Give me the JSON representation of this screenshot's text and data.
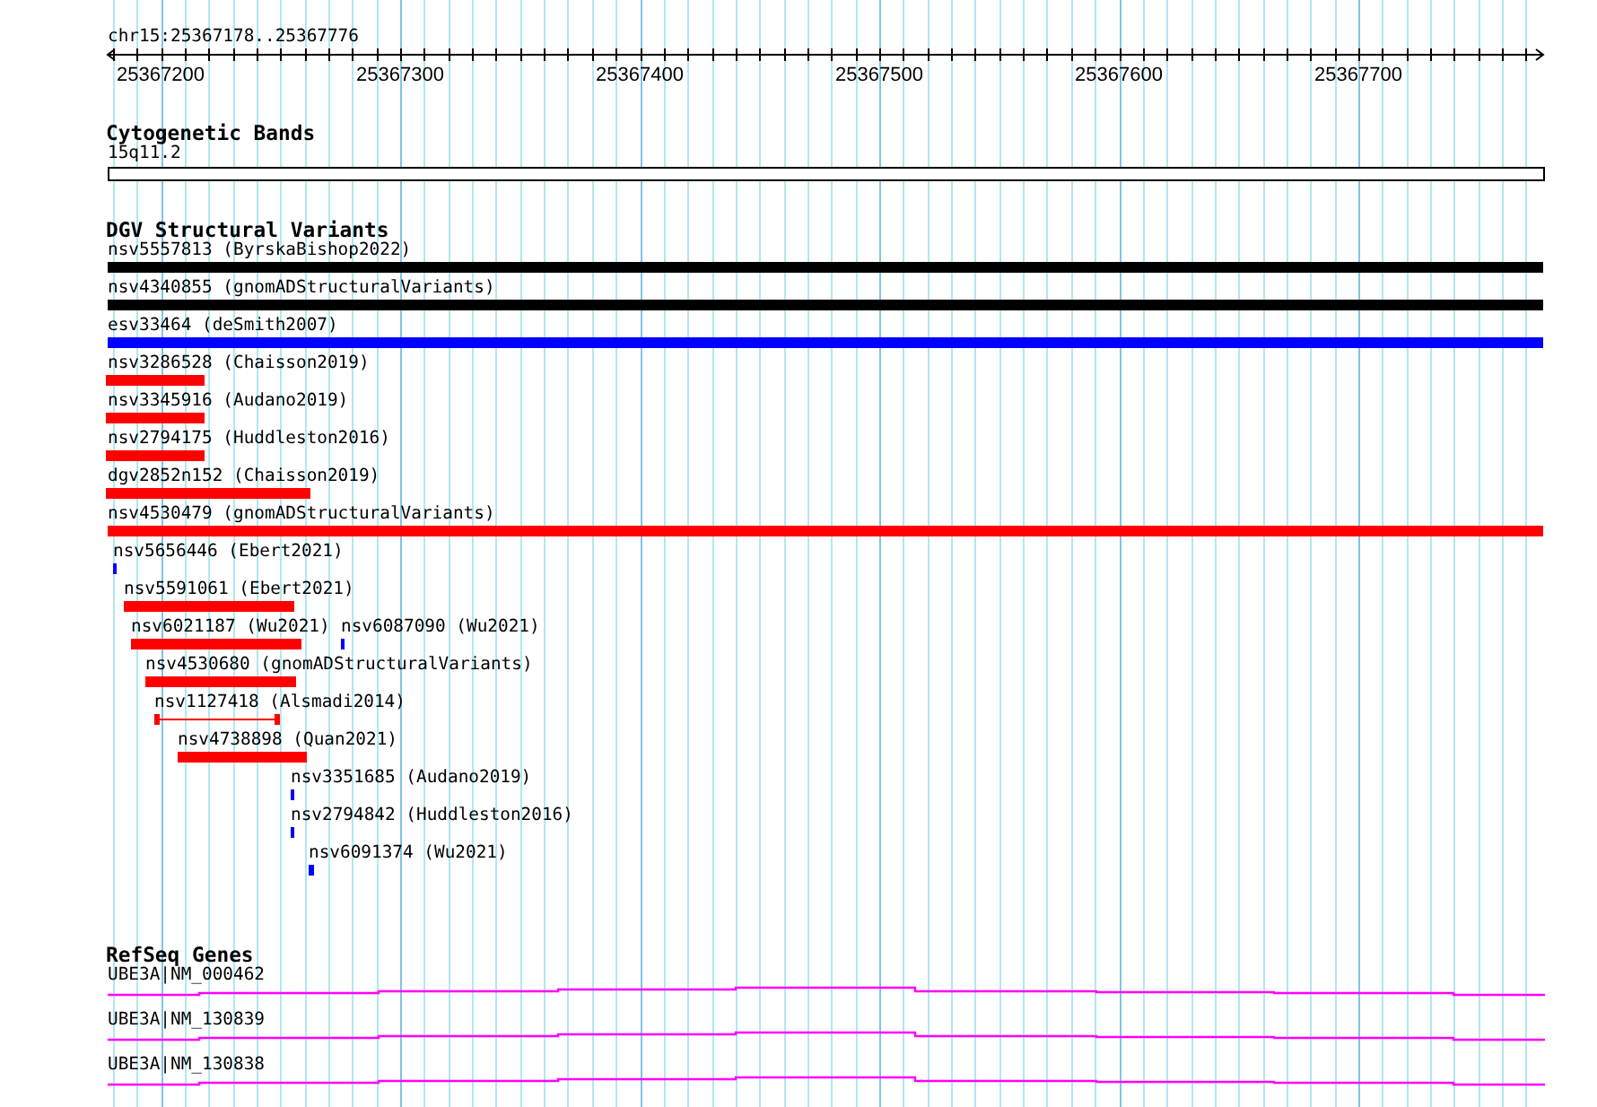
{
  "ruler": {
    "location": "chr15:25367178..25367776",
    "ticks": [
      "25367200",
      "25367300",
      "25367400",
      "25367500",
      "25367600",
      "25367700"
    ]
  },
  "tracks": [
    {
      "title": "Cytogenetic Bands",
      "kind": "bands",
      "features": [
        {
          "label": "15q11.2"
        }
      ]
    },
    {
      "title": "DGV Structural Variants",
      "kind": "variants",
      "features": [
        {
          "label": "nsv5557813 (ByrskaBishop2022)",
          "kind": "bar",
          "color": "#000000"
        },
        {
          "label": "nsv4340855 (gnomADStructuralVariants)",
          "kind": "bar",
          "color": "#000000"
        },
        {
          "label": "esv33464 (deSmith2007)",
          "kind": "bar",
          "color": "#0000ff"
        },
        {
          "label": "nsv3286528 (Chaisson2019)",
          "kind": "bar",
          "color": "#ff0000"
        },
        {
          "label": "nsv3345916 (Audano2019)",
          "kind": "bar",
          "color": "#ff0000"
        },
        {
          "label": "nsv2794175 (Huddleston2016)",
          "kind": "bar",
          "color": "#ff0000"
        },
        {
          "label": "dgv2852n152 (Chaisson2019)",
          "kind": "bar",
          "color": "#ff0000"
        },
        {
          "label": "nsv4530479 (gnomADStructuralVariants)",
          "kind": "bar",
          "color": "#ff0000"
        },
        {
          "label": "nsv5656446 (Ebert2021)",
          "kind": "bar",
          "color": "#0000ff"
        },
        {
          "label": "nsv5591061 (Ebert2021)",
          "kind": "bar",
          "color": "#ff0000"
        },
        {
          "label": "nsv6021187 (Wu2021)",
          "kind": "bar",
          "color": "#ff0000"
        },
        {
          "label": "nsv6087090 (Wu2021)",
          "kind": "bar",
          "color": "#0000ff"
        },
        {
          "label": "nsv4530680 (gnomADStructuralVariants)",
          "kind": "bar",
          "color": "#ff0000"
        },
        {
          "label": "nsv1127418 (Alsmadi2014)",
          "kind": "span",
          "color": "#ff0000"
        },
        {
          "label": "nsv4738898 (Quan2021)",
          "kind": "bar",
          "color": "#ff0000"
        },
        {
          "label": "nsv3351685 (Audano2019)",
          "kind": "bar",
          "color": "#0000ff"
        },
        {
          "label": "nsv2794842 (Huddleston2016)",
          "kind": "bar",
          "color": "#0000ff"
        },
        {
          "label": "nsv6091374 (Wu2021)",
          "kind": "bar",
          "color": "#0000ff"
        }
      ]
    },
    {
      "title": "RefSeq Genes",
      "kind": "genes",
      "features": [
        {
          "label": "UBE3A|NM_000462"
        },
        {
          "label": "UBE3A|NM_130839"
        },
        {
          "label": "UBE3A|NM_130838"
        }
      ]
    }
  ]
}
